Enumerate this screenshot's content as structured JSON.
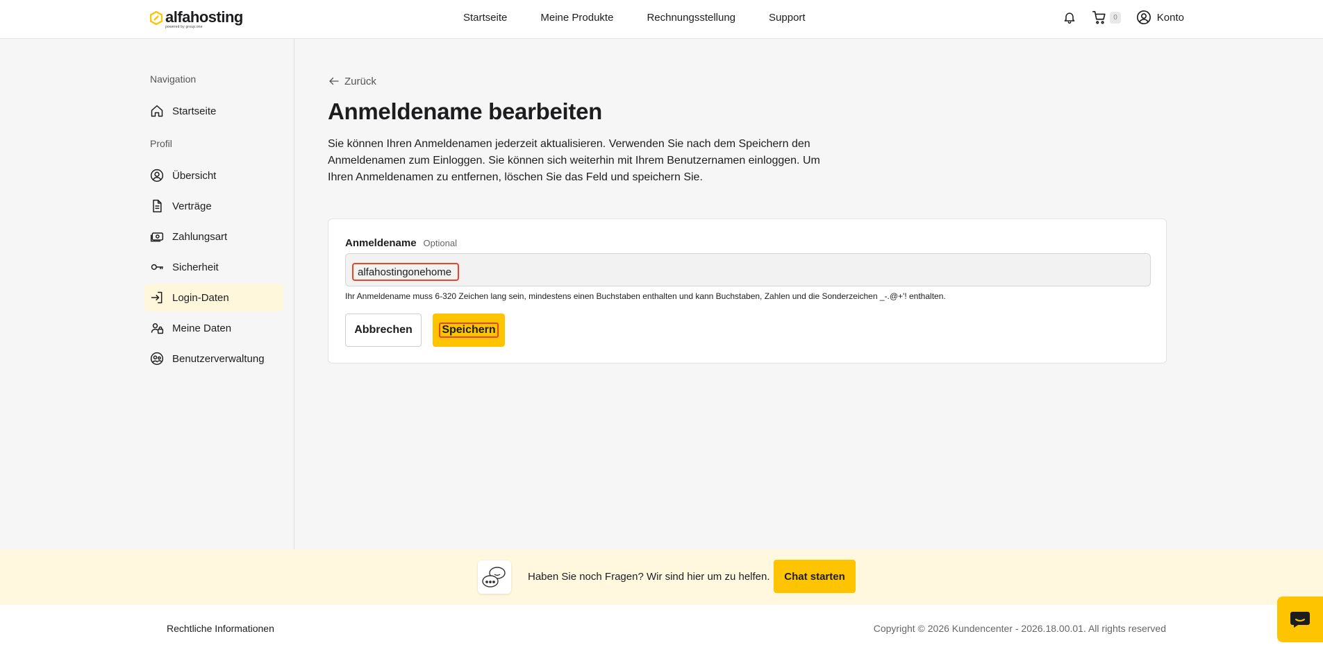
{
  "brand": {
    "name": "alfahosting",
    "tagline": "powered by group.one"
  },
  "nav": {
    "items": [
      {
        "label": "Startseite"
      },
      {
        "label": "Meine Produkte"
      },
      {
        "label": "Rechnungsstellung"
      },
      {
        "label": "Support"
      }
    ],
    "cart_count": "0",
    "account_label": "Konto"
  },
  "sidebar": {
    "section_navigation": "Navigation",
    "section_profile": "Profil",
    "items": [
      {
        "label": "Startseite",
        "icon": "home-icon"
      },
      {
        "label": "Übersicht",
        "icon": "user-circle-icon"
      },
      {
        "label": "Verträge",
        "icon": "document-icon"
      },
      {
        "label": "Zahlungsart",
        "icon": "money-icon"
      },
      {
        "label": "Sicherheit",
        "icon": "key-icon"
      },
      {
        "label": "Login-Daten",
        "icon": "login-icon",
        "active": true
      },
      {
        "label": "Meine Daten",
        "icon": "user-settings-icon"
      },
      {
        "label": "Benutzerverwaltung",
        "icon": "users-icon"
      }
    ]
  },
  "main": {
    "back_label": "Zurück",
    "title": "Anmeldename bearbeiten",
    "description": "Sie können Ihren Anmeldenamen jederzeit aktualisieren. Verwenden Sie nach dem Speichern den Anmeldenamen zum Einloggen. Sie können sich weiterhin mit Ihrem Benutzernamen einloggen. Um Ihren Anmeldenamen zu entfernen, löschen Sie das Feld und speichern Sie.",
    "form": {
      "label": "Anmeldename",
      "optional": "Optional",
      "value": "alfahostingonehome",
      "hint": "Ihr Anmeldename muss 6-320 Zeichen lang sein, mindestens einen Buchstaben enthalten und kann Buchstaben, Zahlen und die Sonderzeichen _-.@+'! enthalten.",
      "cancel_label": "Abbrechen",
      "save_label": "Speichern"
    }
  },
  "help": {
    "text": "Haben Sie noch Fragen? Wir sind hier um zu helfen.",
    "button_label": "Chat starten"
  },
  "footer": {
    "legal": "Rechtliche Informationen",
    "copyright": "Copyright © 2026 Kundencenter - 2026.18.00.01. All rights reserved"
  },
  "colors": {
    "accent": "#ffc400",
    "focus_outline": "#e8442b",
    "active_bg": "#fff7dc"
  }
}
